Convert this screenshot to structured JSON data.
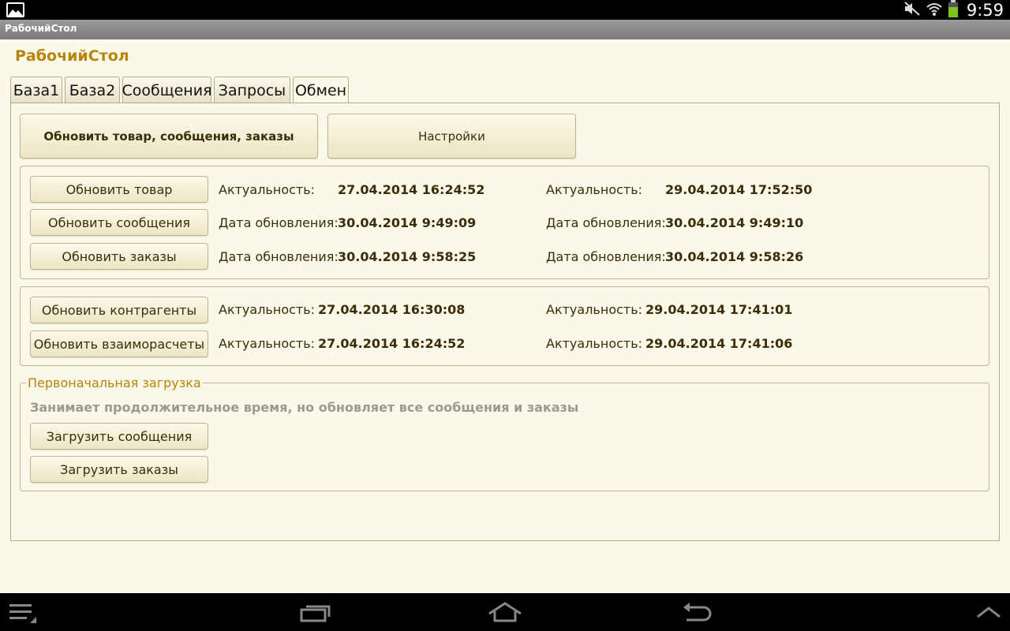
{
  "status_bar": {
    "time": "9:59",
    "icons": [
      "gallery-icon",
      "mute-icon",
      "wifi-icon",
      "battery-icon"
    ]
  },
  "app": {
    "window_title": "РабочийСтол",
    "page_title": "РабочийСтол"
  },
  "tabs": [
    {
      "label": "База1",
      "active": false
    },
    {
      "label": "База2",
      "active": false
    },
    {
      "label": "Сообщения",
      "active": false
    },
    {
      "label": "Запросы",
      "active": false
    },
    {
      "label": "Обмен",
      "active": true
    }
  ],
  "top_buttons": {
    "update_all": "Обновить товар, сообщения, заказы",
    "settings": "Настройки"
  },
  "group1": {
    "rows": [
      {
        "button": "Обновить товар",
        "label1": "Актуальность:",
        "value1": "27.04.2014 16:24:52",
        "label2": "Актуальность:",
        "value2": "29.04.2014 17:52:50"
      },
      {
        "button": "Обновить сообщения",
        "label1": "Дата обновления:",
        "value1": "30.04.2014 9:49:09",
        "label2": "Дата обновления:",
        "value2": "30.04.2014 9:49:10"
      },
      {
        "button": "Обновить заказы",
        "label1": "Дата обновления:",
        "value1": "30.04.2014 9:58:25",
        "label2": "Дата обновления:",
        "value2": "30.04.2014 9:58:26"
      }
    ]
  },
  "group2": {
    "rows": [
      {
        "button": "Обновить контрагенты",
        "label1": "Актуальность:",
        "value1": "27.04.2014 16:30:08",
        "label2": "Актуальность:",
        "value2": "29.04.2014 17:41:01"
      },
      {
        "button": "Обновить взаиморасчеты",
        "label1": "Актуальность:",
        "value1": "27.04.2014 16:24:52",
        "label2": "Актуальность:",
        "value2": "29.04.2014 17:41:06"
      }
    ]
  },
  "initial_load": {
    "title": "Первоначальная загрузка",
    "hint": "Занимает продолжительное время, но обновляет все сообщения и заказы",
    "load_messages": "Загрузить сообщения",
    "load_orders": "Загрузить заказы"
  },
  "nav_bar": {
    "icons": [
      "menu-icon",
      "recent-apps-icon",
      "home-icon",
      "back-icon",
      "up-chevron-icon"
    ]
  },
  "colors": {
    "background": "#faf8e8",
    "accent": "#b8840a",
    "border": "#b3ad88",
    "text": "#3b2d08"
  }
}
